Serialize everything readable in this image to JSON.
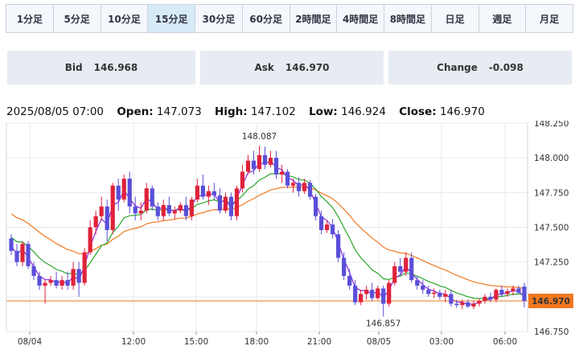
{
  "timeframes": [
    {
      "label": "1分足",
      "active": false
    },
    {
      "label": "5分足",
      "active": false
    },
    {
      "label": "10分足",
      "active": false
    },
    {
      "label": "15分足",
      "active": true
    },
    {
      "label": "30分足",
      "active": false
    },
    {
      "label": "60分足",
      "active": false
    },
    {
      "label": "2時間足",
      "active": false
    },
    {
      "label": "4時間足",
      "active": false
    },
    {
      "label": "8時間足",
      "active": false
    },
    {
      "label": "日足",
      "active": false
    },
    {
      "label": "週足",
      "active": false
    },
    {
      "label": "月足",
      "active": false
    }
  ],
  "quote": {
    "bid_label": "Bid",
    "bid": "146.968",
    "ask_label": "Ask",
    "ask": "146.970",
    "change_label": "Change",
    "change": "-0.098"
  },
  "ohlc": {
    "datetime": "2025/08/05 07:00",
    "open_label": "Open:",
    "open": "147.073",
    "high_label": "High:",
    "high": "147.102",
    "low_label": "Low:",
    "low": "146.924",
    "close_label": "Close:",
    "close": "146.970"
  },
  "colors": {
    "up": "#e0223a",
    "down": "#5a4fd8",
    "ma_fast": "#8a2be2",
    "ma_mid": "#2aa62a",
    "ma_slow": "#f07820",
    "last": "#f07820"
  },
  "chart_data": {
    "type": "candlestick",
    "ylim": [
      146.75,
      148.25
    ],
    "y_ticks": [
      "148.250",
      "148.000",
      "147.750",
      "147.500",
      "147.250",
      "147.000",
      "146.750"
    ],
    "x_ticks": [
      "08/04",
      "12:00",
      "15:00",
      "18:00",
      "21:00",
      "08/05",
      "03:00",
      "06:00"
    ],
    "high_marker": "148.087",
    "low_marker": "146.857",
    "last_price": "146.970",
    "ohlc": [
      [
        147.42,
        147.45,
        147.3,
        147.33
      ],
      [
        147.33,
        147.38,
        147.22,
        147.25
      ],
      [
        147.25,
        147.4,
        147.22,
        147.38
      ],
      [
        147.38,
        147.4,
        147.2,
        147.22
      ],
      [
        147.22,
        147.25,
        147.12,
        147.15
      ],
      [
        147.15,
        147.18,
        147.05,
        147.08
      ],
      [
        147.08,
        147.12,
        146.95,
        147.1
      ],
      [
        147.1,
        147.15,
        147.08,
        147.12
      ],
      [
        147.12,
        147.18,
        147.06,
        147.08
      ],
      [
        147.08,
        147.15,
        147.05,
        147.12
      ],
      [
        147.12,
        147.18,
        147.05,
        147.08
      ],
      [
        147.08,
        147.25,
        147.05,
        147.2
      ],
      [
        147.2,
        147.25,
        147.0,
        147.1
      ],
      [
        147.1,
        147.35,
        147.08,
        147.32
      ],
      [
        147.32,
        147.55,
        147.3,
        147.5
      ],
      [
        147.5,
        147.62,
        147.45,
        147.58
      ],
      [
        147.58,
        147.72,
        147.55,
        147.65
      ],
      [
        147.65,
        147.7,
        147.4,
        147.48
      ],
      [
        147.48,
        147.82,
        147.45,
        147.8
      ],
      [
        147.8,
        147.85,
        147.62,
        147.7
      ],
      [
        147.7,
        147.88,
        147.68,
        147.85
      ],
      [
        147.85,
        147.9,
        147.6,
        147.65
      ],
      [
        147.65,
        147.72,
        147.55,
        147.6
      ],
      [
        147.6,
        147.68,
        147.55,
        147.62
      ],
      [
        147.62,
        147.82,
        147.6,
        147.78
      ],
      [
        147.78,
        147.8,
        147.62,
        147.65
      ],
      [
        147.65,
        147.68,
        147.55,
        147.58
      ],
      [
        147.58,
        147.7,
        147.55,
        147.66
      ],
      [
        147.66,
        147.72,
        147.58,
        147.6
      ],
      [
        147.6,
        147.65,
        147.56,
        147.62
      ],
      [
        147.62,
        147.68,
        147.6,
        147.66
      ],
      [
        147.66,
        147.72,
        147.55,
        147.58
      ],
      [
        147.58,
        147.72,
        147.55,
        147.7
      ],
      [
        147.7,
        147.85,
        147.68,
        147.8
      ],
      [
        147.8,
        147.88,
        147.7,
        147.72
      ],
      [
        147.72,
        147.8,
        147.66,
        147.76
      ],
      [
        147.76,
        147.82,
        147.7,
        147.73
      ],
      [
        147.73,
        147.78,
        147.6,
        147.62
      ],
      [
        147.62,
        147.75,
        147.6,
        147.72
      ],
      [
        147.72,
        147.75,
        147.55,
        147.58
      ],
      [
        147.58,
        147.8,
        147.55,
        147.78
      ],
      [
        147.78,
        147.95,
        147.75,
        147.9
      ],
      [
        147.9,
        148.02,
        147.88,
        147.98
      ],
      [
        147.98,
        148.05,
        147.88,
        147.92
      ],
      [
        147.92,
        148.087,
        147.9,
        148.02
      ],
      [
        148.02,
        148.08,
        147.92,
        147.95
      ],
      [
        147.95,
        148.05,
        147.93,
        148.0
      ],
      [
        148.0,
        148.05,
        147.85,
        147.88
      ],
      [
        147.88,
        147.95,
        147.82,
        147.9
      ],
      [
        147.9,
        147.92,
        147.78,
        147.8
      ],
      [
        147.8,
        147.85,
        147.75,
        147.82
      ],
      [
        147.82,
        147.86,
        147.72,
        147.76
      ],
      [
        147.76,
        147.85,
        147.74,
        147.82
      ],
      [
        147.82,
        147.84,
        147.7,
        147.72
      ],
      [
        147.72,
        147.74,
        147.55,
        147.58
      ],
      [
        147.58,
        147.62,
        147.45,
        147.48
      ],
      [
        147.48,
        147.55,
        147.46,
        147.52
      ],
      [
        147.52,
        147.56,
        147.42,
        147.45
      ],
      [
        147.45,
        147.48,
        147.25,
        147.28
      ],
      [
        147.28,
        147.32,
        147.12,
        147.15
      ],
      [
        147.15,
        147.2,
        147.05,
        147.08
      ],
      [
        147.08,
        147.12,
        146.94,
        146.96
      ],
      [
        146.96,
        147.05,
        146.94,
        147.02
      ],
      [
        147.02,
        147.08,
        146.98,
        147.05
      ],
      [
        147.05,
        147.1,
        146.97,
        146.99
      ],
      [
        146.99,
        147.08,
        146.98,
        147.06
      ],
      [
        147.06,
        147.08,
        146.857,
        146.95
      ],
      [
        146.95,
        147.12,
        146.93,
        147.1
      ],
      [
        147.1,
        147.25,
        147.08,
        147.22
      ],
      [
        147.22,
        147.28,
        147.15,
        147.18
      ],
      [
        147.18,
        147.32,
        147.15,
        147.28
      ],
      [
        147.28,
        147.32,
        147.1,
        147.12
      ],
      [
        147.12,
        147.15,
        147.05,
        147.08
      ],
      [
        147.08,
        147.12,
        147.02,
        147.05
      ],
      [
        147.05,
        147.08,
        147.0,
        147.02
      ],
      [
        147.02,
        147.06,
        146.99,
        147.03
      ],
      [
        147.03,
        147.05,
        146.98,
        147.0
      ],
      [
        147.0,
        147.05,
        146.96,
        147.02
      ],
      [
        147.02,
        147.05,
        146.93,
        146.95
      ],
      [
        146.95,
        146.98,
        146.92,
        146.94
      ],
      [
        146.94,
        146.98,
        146.91,
        146.96
      ],
      [
        146.96,
        146.98,
        146.92,
        146.93
      ],
      [
        146.93,
        146.97,
        146.91,
        146.95
      ],
      [
        146.95,
        146.99,
        146.93,
        146.97
      ],
      [
        146.97,
        147.02,
        146.95,
        147.0
      ],
      [
        147.0,
        147.03,
        146.96,
        146.98
      ],
      [
        146.98,
        147.06,
        146.96,
        147.05
      ],
      [
        147.05,
        147.08,
        147.0,
        147.02
      ],
      [
        147.02,
        147.06,
        147.0,
        147.04
      ],
      [
        147.04,
        147.08,
        147.01,
        147.06
      ],
      [
        147.06,
        147.08,
        147.02,
        147.03
      ],
      [
        147.073,
        147.102,
        146.924,
        146.97
      ]
    ]
  }
}
